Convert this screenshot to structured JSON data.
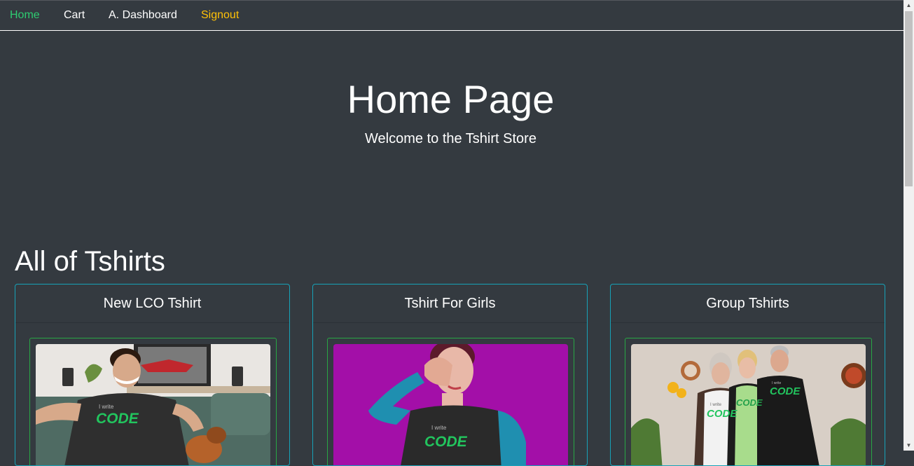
{
  "nav": {
    "home": "Home",
    "cart": "Cart",
    "dashboard": "A. Dashboard",
    "signout": "Signout"
  },
  "hero": {
    "title": "Home Page",
    "subtitle": "Welcome to the Tshirt Store"
  },
  "section": {
    "title": "All of Tshirts"
  },
  "products": [
    {
      "name": "New LCO Tshirt",
      "image_text": {
        "line1": "I write",
        "line2": "CODE"
      }
    },
    {
      "name": "Tshirt For Girls",
      "image_text": {
        "line1": "I write",
        "line2": "CODE"
      }
    },
    {
      "name": "Group Tshirts",
      "image_text": {
        "line1": "I write",
        "line2": "CODE"
      }
    }
  ],
  "colors": {
    "background": "#343a40",
    "nav_active": "#2ecc71",
    "nav_signout": "#ffc107",
    "card_border": "#17a2b8",
    "image_border": "#28a745"
  },
  "icons": {
    "scroll_up": "▲",
    "scroll_down": "▼"
  }
}
